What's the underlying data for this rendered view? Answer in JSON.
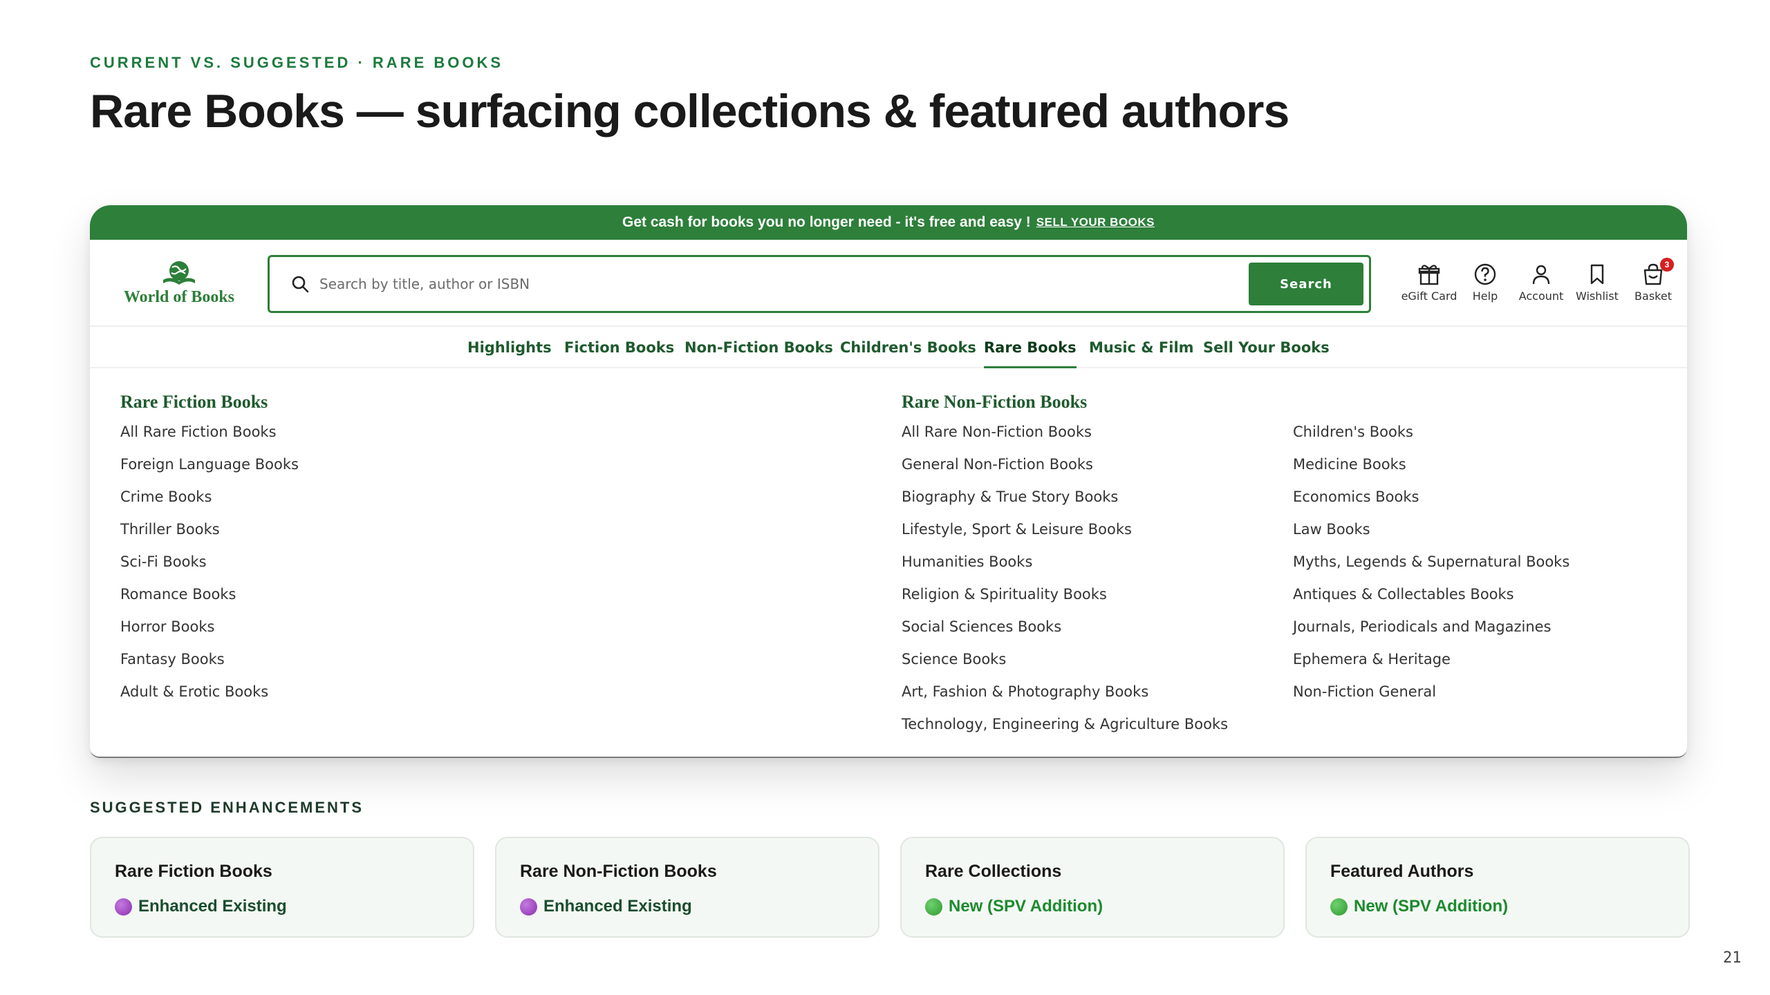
{
  "slide": {
    "eyebrow": "CURRENT VS. SUGGESTED · RARE BOOKS",
    "title": "Rare Books — surfacing collections & featured authors",
    "page_number": "21"
  },
  "promo": {
    "text": "Get cash for books you no longer need - it's free and easy !",
    "link": "SELL YOUR BOOKS"
  },
  "site": {
    "logo_text": "World of Books",
    "search_placeholder": "Search by title, author or ISBN",
    "search_button": "Search",
    "utilities": [
      {
        "label": "eGift Card",
        "icon": "gift-icon"
      },
      {
        "label": "Help",
        "icon": "help-icon"
      },
      {
        "label": "Account",
        "icon": "account-icon"
      },
      {
        "label": "Wishlist",
        "icon": "bookmark-icon"
      },
      {
        "label": "Basket",
        "icon": "basket-icon",
        "badge": "3"
      }
    ],
    "nav": [
      "Highlights",
      "Fiction Books",
      "Non-Fiction Books",
      "Children's Books",
      "Rare Books",
      "Music & Film",
      "Sell Your Books"
    ],
    "nav_active": "Rare Books"
  },
  "menu": {
    "fiction": {
      "heading": "Rare Fiction Books",
      "items": [
        "All Rare Fiction Books",
        "Foreign Language Books",
        "Crime Books",
        "Thriller Books",
        "Sci-Fi Books",
        "Romance Books",
        "Horror Books",
        "Fantasy Books",
        "Adult & Erotic Books"
      ]
    },
    "nonfiction": {
      "heading": "Rare Non-Fiction Books",
      "items_col1": [
        "All Rare Non-Fiction Books",
        "General Non-Fiction Books",
        "Biography & True Story Books",
        "Lifestyle, Sport & Leisure Books",
        "Humanities Books",
        "Religion & Spirituality Books",
        "Social Sciences Books",
        "Science Books",
        "Art, Fashion & Photography Books",
        "Technology, Engineering & Agriculture Books"
      ],
      "items_col2": [
        "Children's Books",
        "Medicine Books",
        "Economics Books",
        "Law Books",
        "Myths, Legends & Supernatural Books",
        "Antiques & Collectables Books",
        "Journals, Periodicals and Magazines",
        "Ephemera & Heritage",
        "Non-Fiction General"
      ]
    }
  },
  "suggestions": {
    "label": "SUGGESTED ENHANCEMENTS",
    "cards": [
      {
        "title": "Rare Fiction Books",
        "status": "Enhanced Existing",
        "kind": "enhanced"
      },
      {
        "title": "Rare Non-Fiction Books",
        "status": "Enhanced Existing",
        "kind": "enhanced"
      },
      {
        "title": "Rare Collections",
        "status": "New (SPV Addition)",
        "kind": "new"
      },
      {
        "title": "Featured Authors",
        "status": "New (SPV Addition)",
        "kind": "new"
      }
    ]
  },
  "colors": {
    "brand_green": "#2d7f3a",
    "eyebrow_green": "#1c7a3c",
    "badge_red": "#d32020"
  }
}
